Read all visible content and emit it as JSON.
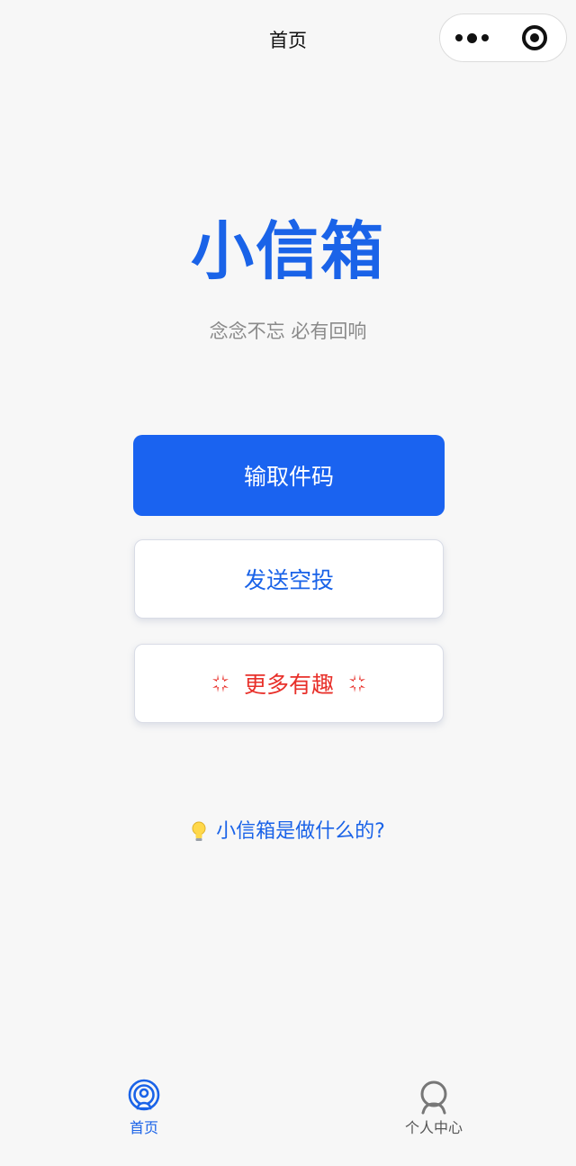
{
  "navbar": {
    "title": "首页",
    "more_icon": "more-dots-icon",
    "close_icon": "mini-program-close-icon"
  },
  "hero": {
    "title": "小信箱",
    "slogan": "念念不忘 必有回响"
  },
  "actions": {
    "enter_code": "输取件码",
    "send_airdrop": "发送空投",
    "more_fun": "更多有趣",
    "more_fun_icon": "anger-symbol-icon"
  },
  "help": {
    "label": "小信箱是做什么的?",
    "icon": "light-bulb-icon"
  },
  "tabbar": {
    "home": {
      "label": "首页",
      "icon": "broadcast-icon",
      "active": true
    },
    "profile": {
      "label": "个人中心",
      "icon": "user-icon",
      "active": false
    }
  },
  "colors": {
    "primary": "#1a63f0",
    "accent_text": "#1a63e8",
    "highlight": "#e8302a",
    "background": "#f7f7f7"
  }
}
